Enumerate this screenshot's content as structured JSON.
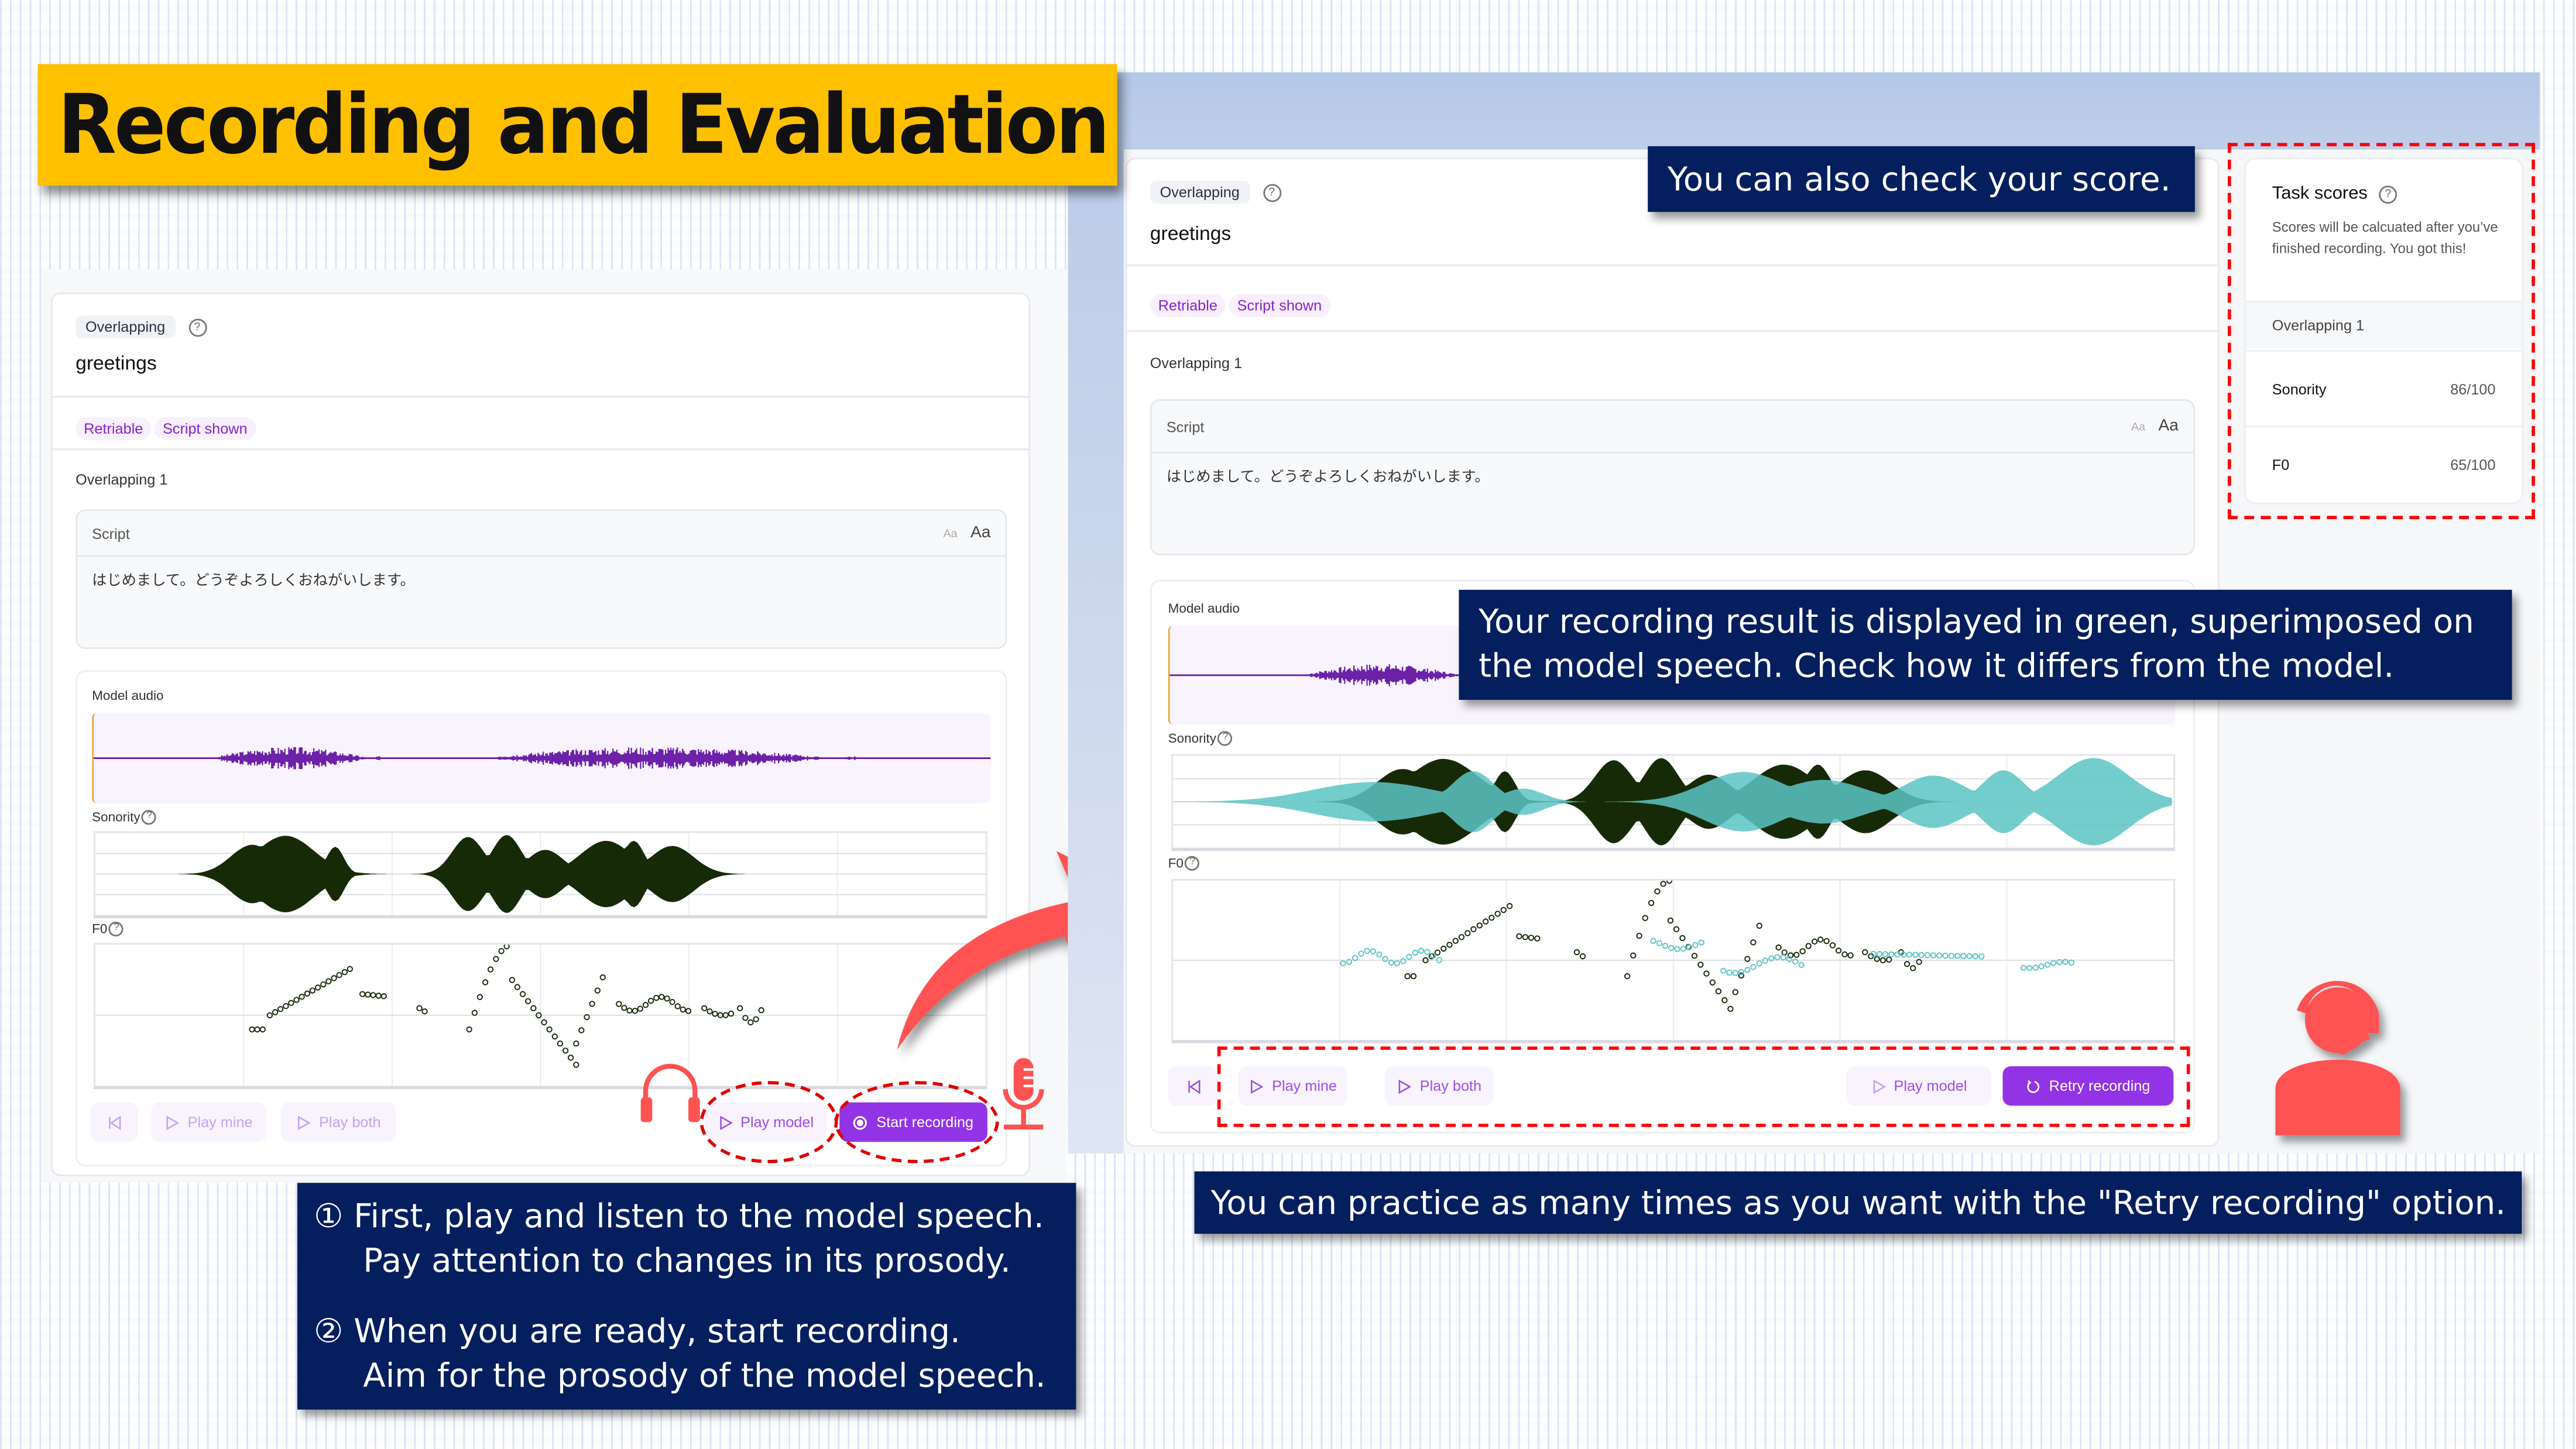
{
  "title": "Recording and Evaluation",
  "colors": {
    "banner": "#ffc000",
    "note_bg": "#041e5e",
    "accent_purple": "#9333e6",
    "tag_text": "#8a22c9",
    "waveform": "#6b21a8",
    "model_sonority": "#172a08",
    "user_trace": "#5cc4c4",
    "annotation_red": "#ff5252"
  },
  "left_app": {
    "chip": "Overlapping",
    "task_title": "greetings",
    "tags": [
      "Retriable",
      "Script shown"
    ],
    "section": "Overlapping 1",
    "script_label": "Script",
    "aa_small": "Aa",
    "aa_big": "Aa",
    "script_text": "はじめまして。どうぞよろしくおねがいします。",
    "model_audio_label": "Model audio",
    "sonority_label": "Sonority",
    "f0_label": "F0",
    "buttons": {
      "restart": "",
      "play_mine": "Play mine",
      "play_both": "Play both",
      "play_model": "Play model",
      "start_recording": "Start recording"
    }
  },
  "right_app": {
    "chip": "Overlapping",
    "task_title": "greetings",
    "tags": [
      "Retriable",
      "Script shown"
    ],
    "section": "Overlapping 1",
    "script_label": "Script",
    "aa_small": "Aa",
    "aa_big": "Aa",
    "script_text": "はじめまして。どうぞよろしくおねがいします。",
    "model_audio_label": "Model audio",
    "sonority_label": "Sonority",
    "f0_label": "F0",
    "buttons": {
      "play_mine": "Play mine",
      "play_both": "Play both",
      "play_model": "Play model",
      "retry_recording": "Retry recording"
    },
    "scores": {
      "title": "Task scores",
      "description": "Scores will be calcuated after you’ve finished recording. You got this!",
      "group": "Overlapping 1",
      "rows": [
        {
          "label": "Sonority",
          "value": "86/100"
        },
        {
          "label": "F0",
          "value": "65/100"
        }
      ]
    }
  },
  "notes": {
    "score": "You can also check your score.",
    "result_line1": "Your recording result is displayed in green, superimposed on",
    "result_line2": "the model speech. Check how it differs from the model.",
    "retry": "You can practice as many times as you want with the \"Retry recording\" option.",
    "step1_num": "①",
    "step1_line1": "First, play and listen to the model speech.",
    "step1_line2": "Pay attention to changes in its prosody.",
    "step2_num": "②",
    "step2_line1": "When you are ready, start recording.",
    "step2_line2": "Aim for the prosody of the model speech."
  },
  "icons": {
    "headphones": "headphones-icon",
    "microphone": "microphone-icon",
    "arrow": "curved-arrow-icon",
    "operator": "operator-headset-icon"
  }
}
